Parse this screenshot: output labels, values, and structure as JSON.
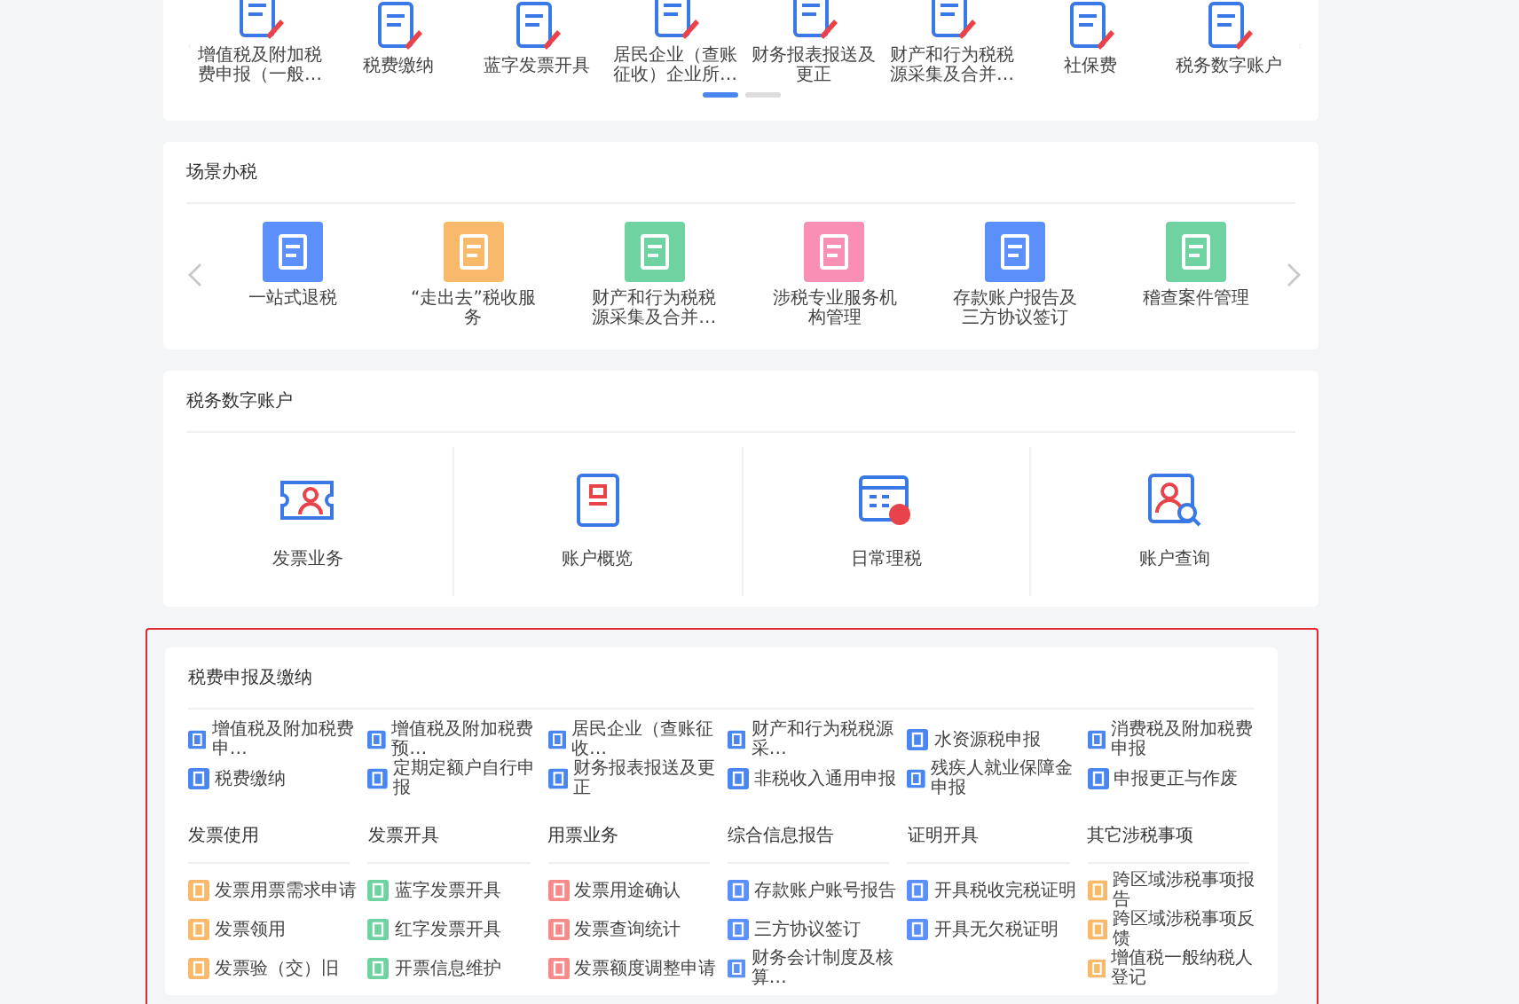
{
  "top_services": {
    "items": [
      {
        "label": "增值税及附加税费申报（一般…"
      },
      {
        "label": "税费缴纳"
      },
      {
        "label": "蓝字发票开具"
      },
      {
        "label": "居民企业（查账征收）企业所…"
      },
      {
        "label": "财务报表报送及更正"
      },
      {
        "label": "财产和行为税税源采集及合并…"
      },
      {
        "label": "社保费"
      },
      {
        "label": "税务数字账户"
      }
    ],
    "pages": [
      {
        "selected": true
      },
      {
        "selected": false
      }
    ]
  },
  "scene_tax": {
    "title": "场景办税",
    "items": [
      {
        "label": "一站式退税",
        "color": "#5b8ff9"
      },
      {
        "label": "“走出去”税收服务",
        "color": "#f9b96a"
      },
      {
        "label": "财产和行为税税源采集及合并…",
        "color": "#6fd3a1"
      },
      {
        "label": "涉税专业服务机构管理",
        "color": "#f98fb4"
      },
      {
        "label": "存款账户报告及三方协议签订",
        "color": "#5b8ff9"
      },
      {
        "label": "稽查案件管理",
        "color": "#6fd3a1"
      }
    ]
  },
  "digital_account": {
    "title": "税务数字账户",
    "items": [
      {
        "label": "发票业务"
      },
      {
        "label": "账户概览"
      },
      {
        "label": "日常理税"
      },
      {
        "label": "账户查询"
      }
    ]
  },
  "declaration": {
    "highlighted": true,
    "title": "税费申报及缴纳",
    "items": [
      {
        "label": "增值税及附加税费申…"
      },
      {
        "label": "增值税及附加税费预…"
      },
      {
        "label": "居民企业（查账征收…"
      },
      {
        "label": "财产和行为税税源采…"
      },
      {
        "label": "水资源税申报"
      },
      {
        "label": "消费税及附加税费申报"
      },
      {
        "label": "税费缴纳"
      },
      {
        "label": "定期定额户自行申报"
      },
      {
        "label": "财务报表报送及更正"
      },
      {
        "label": "非税收入通用申报"
      },
      {
        "label": "残疾人就业保障金申报"
      },
      {
        "label": "申报更正与作废"
      }
    ],
    "groups": [
      {
        "title": "发票使用",
        "color": "#f9b96a",
        "items": [
          {
            "label": "发票用票需求申请"
          },
          {
            "label": "发票领用"
          },
          {
            "label": "发票验（交）旧"
          }
        ]
      },
      {
        "title": "发票开具",
        "color": "#6fd3a1",
        "items": [
          {
            "label": "蓝字发票开具"
          },
          {
            "label": "红字发票开具"
          },
          {
            "label": "开票信息维护"
          }
        ]
      },
      {
        "title": "用票业务",
        "color": "#f78a8a",
        "items": [
          {
            "label": "发票用途确认"
          },
          {
            "label": "发票查询统计"
          },
          {
            "label": "发票额度调整申请"
          }
        ]
      },
      {
        "title": "综合信息报告",
        "color": "#5b8ff9",
        "items": [
          {
            "label": "存款账户账号报告"
          },
          {
            "label": "三方协议签订"
          },
          {
            "label": "财务会计制度及核算…"
          }
        ]
      },
      {
        "title": "证明开具",
        "color": "#5b8ff9",
        "items": [
          {
            "label": "开具税收完税证明"
          },
          {
            "label": "开具无欠税证明"
          }
        ]
      },
      {
        "title": "其它涉税事项",
        "color": "#f9b96a",
        "items": [
          {
            "label": "跨区域涉税事项报告"
          },
          {
            "label": "跨区域涉税事项反馈"
          },
          {
            "label": "增值税一般纳税人登记"
          }
        ]
      }
    ]
  }
}
